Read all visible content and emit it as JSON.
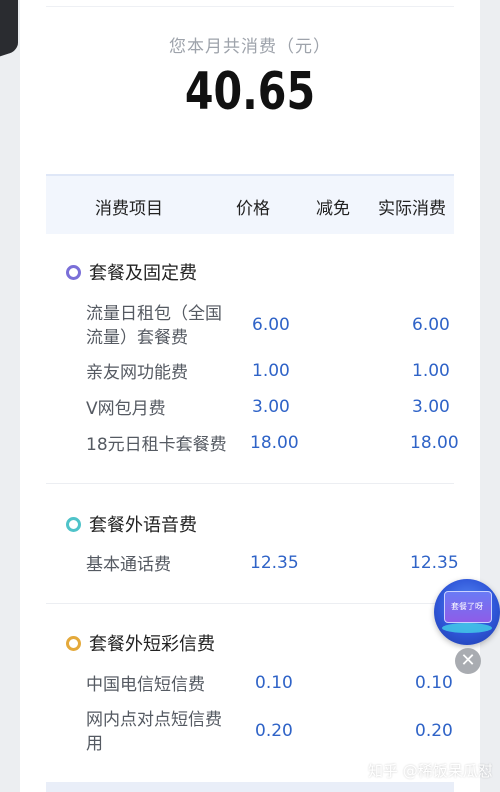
{
  "summary": {
    "label": "您本月共消费（元）",
    "amount": "40.65"
  },
  "table": {
    "headers": [
      "消费项目",
      "价格",
      "减免",
      "实际消费"
    ]
  },
  "sections": [
    {
      "title": "套餐及固定费",
      "dot_color": "#7a6fd8",
      "rows": [
        {
          "name_lines": [
            "流量日租包（全国",
            "流量）套餐费"
          ],
          "price": "6.00",
          "actual": "6.00"
        },
        {
          "name_lines": [
            "亲友网功能费"
          ],
          "price": "1.00",
          "actual": "1.00"
        },
        {
          "name_lines": [
            "V网包月费"
          ],
          "price": "3.00",
          "actual": "3.00"
        },
        {
          "name_lines": [
            "18元日租卡套餐费"
          ],
          "price": "18.00",
          "actual": "18.00"
        }
      ]
    },
    {
      "title": "套餐外语音费",
      "dot_color": "#4fc3c9",
      "rows": [
        {
          "name_lines": [
            "基本通话费"
          ],
          "price": "12.35",
          "actual": "12.35"
        }
      ]
    },
    {
      "title": "套餐外短彩信费",
      "dot_color": "#e4a93b",
      "rows": [
        {
          "name_lines": [
            "中国电信短信费"
          ],
          "price": "0.10",
          "actual": "0.10"
        },
        {
          "name_lines": [
            "网内点对点短信费",
            "用"
          ],
          "price": "0.20",
          "actual": "0.20"
        }
      ]
    }
  ],
  "floating_ad": {
    "text": "套餐了呀"
  },
  "icons": {
    "close": "close-icon"
  },
  "watermark": "知乎 @稀饭呆瓜怼"
}
